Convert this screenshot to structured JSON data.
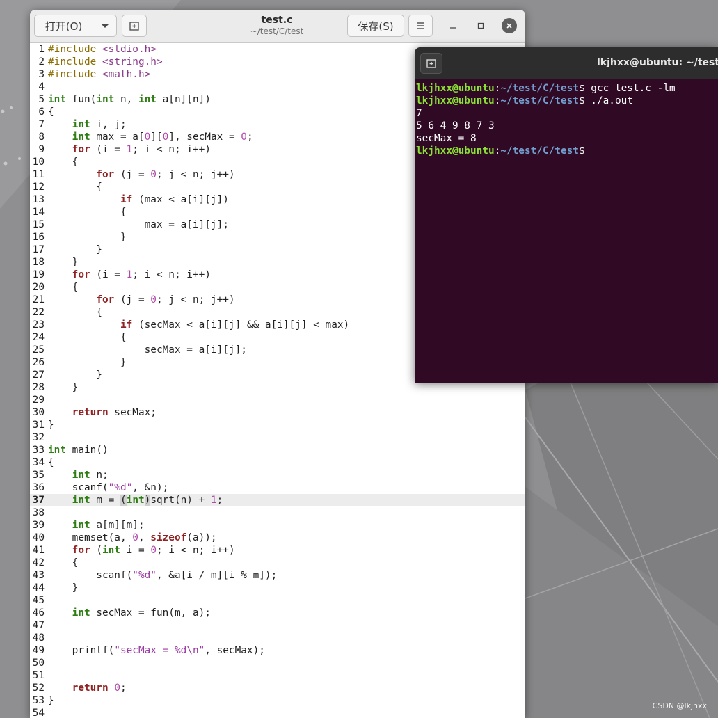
{
  "editor": {
    "title": "test.c",
    "path": "~/test/C/test",
    "open_label": "打开(O)",
    "save_label": "保存(S)",
    "current_line": 37,
    "lines": [
      {
        "n": "1",
        "segs": [
          [
            "pp",
            "#include "
          ],
          [
            "hdr",
            "<stdio.h>"
          ]
        ]
      },
      {
        "n": "2",
        "segs": [
          [
            "pp",
            "#include "
          ],
          [
            "hdr",
            "<string.h>"
          ]
        ]
      },
      {
        "n": "3",
        "segs": [
          [
            "pp",
            "#include "
          ],
          [
            "hdr",
            "<math.h>"
          ]
        ]
      },
      {
        "n": "4",
        "segs": []
      },
      {
        "n": "5",
        "segs": [
          [
            "ty",
            "int"
          ],
          [
            "",
            " fun("
          ],
          [
            "ty",
            "int"
          ],
          [
            "",
            " n, "
          ],
          [
            "ty",
            "int"
          ],
          [
            "",
            " a[n][n])"
          ]
        ]
      },
      {
        "n": "6",
        "segs": [
          [
            "",
            "{"
          ]
        ]
      },
      {
        "n": "7",
        "segs": [
          [
            "",
            "    "
          ],
          [
            "ty",
            "int"
          ],
          [
            "",
            " i, j;"
          ]
        ]
      },
      {
        "n": "8",
        "segs": [
          [
            "",
            "    "
          ],
          [
            "ty",
            "int"
          ],
          [
            "",
            " max = a["
          ],
          [
            "num",
            "0"
          ],
          [
            "",
            "]["
          ],
          [
            "num",
            "0"
          ],
          [
            "",
            "], secMax = "
          ],
          [
            "num",
            "0"
          ],
          [
            "",
            ";"
          ]
        ]
      },
      {
        "n": "9",
        "segs": [
          [
            "",
            "    "
          ],
          [
            "fl",
            "for"
          ],
          [
            "",
            " (i = "
          ],
          [
            "num",
            "1"
          ],
          [
            "",
            "; i < n; i++)"
          ]
        ]
      },
      {
        "n": "10",
        "segs": [
          [
            "",
            "    {"
          ]
        ]
      },
      {
        "n": "11",
        "segs": [
          [
            "",
            "        "
          ],
          [
            "fl",
            "for"
          ],
          [
            "",
            " (j = "
          ],
          [
            "num",
            "0"
          ],
          [
            "",
            "; j < n; j++)"
          ]
        ]
      },
      {
        "n": "12",
        "segs": [
          [
            "",
            "        {"
          ]
        ]
      },
      {
        "n": "13",
        "segs": [
          [
            "",
            "            "
          ],
          [
            "fl",
            "if"
          ],
          [
            "",
            " (max < a[i][j])"
          ]
        ]
      },
      {
        "n": "14",
        "segs": [
          [
            "",
            "            {"
          ]
        ]
      },
      {
        "n": "15",
        "segs": [
          [
            "",
            "                max = a[i][j];"
          ]
        ]
      },
      {
        "n": "16",
        "segs": [
          [
            "",
            "            }"
          ]
        ]
      },
      {
        "n": "17",
        "segs": [
          [
            "",
            "        }"
          ]
        ]
      },
      {
        "n": "18",
        "segs": [
          [
            "",
            "    }"
          ]
        ]
      },
      {
        "n": "19",
        "segs": [
          [
            "",
            "    "
          ],
          [
            "fl",
            "for"
          ],
          [
            "",
            " (i = "
          ],
          [
            "num",
            "1"
          ],
          [
            "",
            "; i < n; i++)"
          ]
        ]
      },
      {
        "n": "20",
        "segs": [
          [
            "",
            "    {"
          ]
        ]
      },
      {
        "n": "21",
        "segs": [
          [
            "",
            "        "
          ],
          [
            "fl",
            "for"
          ],
          [
            "",
            " (j = "
          ],
          [
            "num",
            "0"
          ],
          [
            "",
            "; j < n; j++)"
          ]
        ]
      },
      {
        "n": "22",
        "segs": [
          [
            "",
            "        {"
          ]
        ]
      },
      {
        "n": "23",
        "segs": [
          [
            "",
            "            "
          ],
          [
            "fl",
            "if"
          ],
          [
            "",
            " (secMax < a[i][j] && a[i][j] < max)"
          ]
        ]
      },
      {
        "n": "24",
        "segs": [
          [
            "",
            "            {"
          ]
        ]
      },
      {
        "n": "25",
        "segs": [
          [
            "",
            "                secMax = a[i][j];"
          ]
        ]
      },
      {
        "n": "26",
        "segs": [
          [
            "",
            "            }"
          ]
        ]
      },
      {
        "n": "27",
        "segs": [
          [
            "",
            "        }"
          ]
        ]
      },
      {
        "n": "28",
        "segs": [
          [
            "",
            "    }"
          ]
        ]
      },
      {
        "n": "29",
        "segs": []
      },
      {
        "n": "30",
        "segs": [
          [
            "",
            "    "
          ],
          [
            "fl",
            "return"
          ],
          [
            "",
            " secMax;"
          ]
        ]
      },
      {
        "n": "31",
        "segs": [
          [
            "",
            "}"
          ]
        ]
      },
      {
        "n": "32",
        "segs": []
      },
      {
        "n": "33",
        "segs": [
          [
            "ty",
            "int"
          ],
          [
            "",
            " main()"
          ]
        ]
      },
      {
        "n": "34",
        "segs": [
          [
            "",
            "{"
          ]
        ]
      },
      {
        "n": "35",
        "segs": [
          [
            "",
            "    "
          ],
          [
            "ty",
            "int"
          ],
          [
            "",
            " n;"
          ]
        ]
      },
      {
        "n": "36",
        "segs": [
          [
            "",
            "    scanf("
          ],
          [
            "str",
            "\"%d\""
          ],
          [
            "",
            ", &n);"
          ]
        ]
      },
      {
        "n": "37",
        "segs": [
          [
            "",
            "    "
          ],
          [
            "ty",
            "int"
          ],
          [
            "",
            " m = "
          ],
          [
            "brk",
            "("
          ],
          [
            "ty",
            "int"
          ],
          [
            "brk",
            ")"
          ],
          [
            "",
            "sqrt(n) + "
          ],
          [
            "num",
            "1"
          ],
          [
            "",
            ";"
          ]
        ]
      },
      {
        "n": "38",
        "segs": []
      },
      {
        "n": "39",
        "segs": [
          [
            "",
            "    "
          ],
          [
            "ty",
            "int"
          ],
          [
            "",
            " a[m][m];"
          ]
        ]
      },
      {
        "n": "40",
        "segs": [
          [
            "",
            "    memset(a, "
          ],
          [
            "num",
            "0"
          ],
          [
            "",
            ", "
          ],
          [
            "fl",
            "sizeof"
          ],
          [
            "",
            "(a));"
          ]
        ]
      },
      {
        "n": "41",
        "segs": [
          [
            "",
            "    "
          ],
          [
            "fl",
            "for"
          ],
          [
            "",
            " ("
          ],
          [
            "ty",
            "int"
          ],
          [
            "",
            " i = "
          ],
          [
            "num",
            "0"
          ],
          [
            "",
            "; i < n; i++)"
          ]
        ]
      },
      {
        "n": "42",
        "segs": [
          [
            "",
            "    {"
          ]
        ]
      },
      {
        "n": "43",
        "segs": [
          [
            "",
            "        scanf("
          ],
          [
            "str",
            "\"%d\""
          ],
          [
            "",
            ", &a[i / m][i % m]);"
          ]
        ]
      },
      {
        "n": "44",
        "segs": [
          [
            "",
            "    }"
          ]
        ]
      },
      {
        "n": "45",
        "segs": []
      },
      {
        "n": "46",
        "segs": [
          [
            "",
            "    "
          ],
          [
            "ty",
            "int"
          ],
          [
            "",
            " secMax = fun(m, a);"
          ]
        ]
      },
      {
        "n": "47",
        "segs": []
      },
      {
        "n": "48",
        "segs": []
      },
      {
        "n": "49",
        "segs": [
          [
            "",
            "    printf("
          ],
          [
            "str",
            "\"secMax = %d\\n\""
          ],
          [
            "",
            ", secMax);"
          ]
        ]
      },
      {
        "n": "50",
        "segs": []
      },
      {
        "n": "51",
        "segs": []
      },
      {
        "n": "52",
        "segs": [
          [
            "",
            "    "
          ],
          [
            "fl",
            "return"
          ],
          [
            "",
            " "
          ],
          [
            "num",
            "0"
          ],
          [
            "",
            ";"
          ]
        ]
      },
      {
        "n": "53",
        "segs": [
          [
            "",
            "}"
          ]
        ]
      },
      {
        "n": "54",
        "segs": []
      }
    ]
  },
  "terminal": {
    "title": "lkjhxx@ubuntu: ~/test/C/test",
    "lines": [
      {
        "user": "lkjhxx@ubuntu",
        "path": "~/test/C/test",
        "cmd": " gcc test.c -lm"
      },
      {
        "user": "lkjhxx@ubuntu",
        "path": "~/test/C/test",
        "cmd": " ./a.out"
      },
      {
        "text": "7"
      },
      {
        "text": "5 6 4 9 8 7 3"
      },
      {
        "text": "secMax = 8"
      },
      {
        "user": "lkjhxx@ubuntu",
        "path": "~/test/C/test",
        "cmd": ""
      }
    ]
  },
  "watermark": "CSDN @lkjhxx",
  "colors": {
    "terminal_bg": "#300a24",
    "prompt_user": "#8ae234",
    "prompt_path": "#729fcf",
    "keyword": "#2e7d12",
    "number": "#b04aa8"
  }
}
